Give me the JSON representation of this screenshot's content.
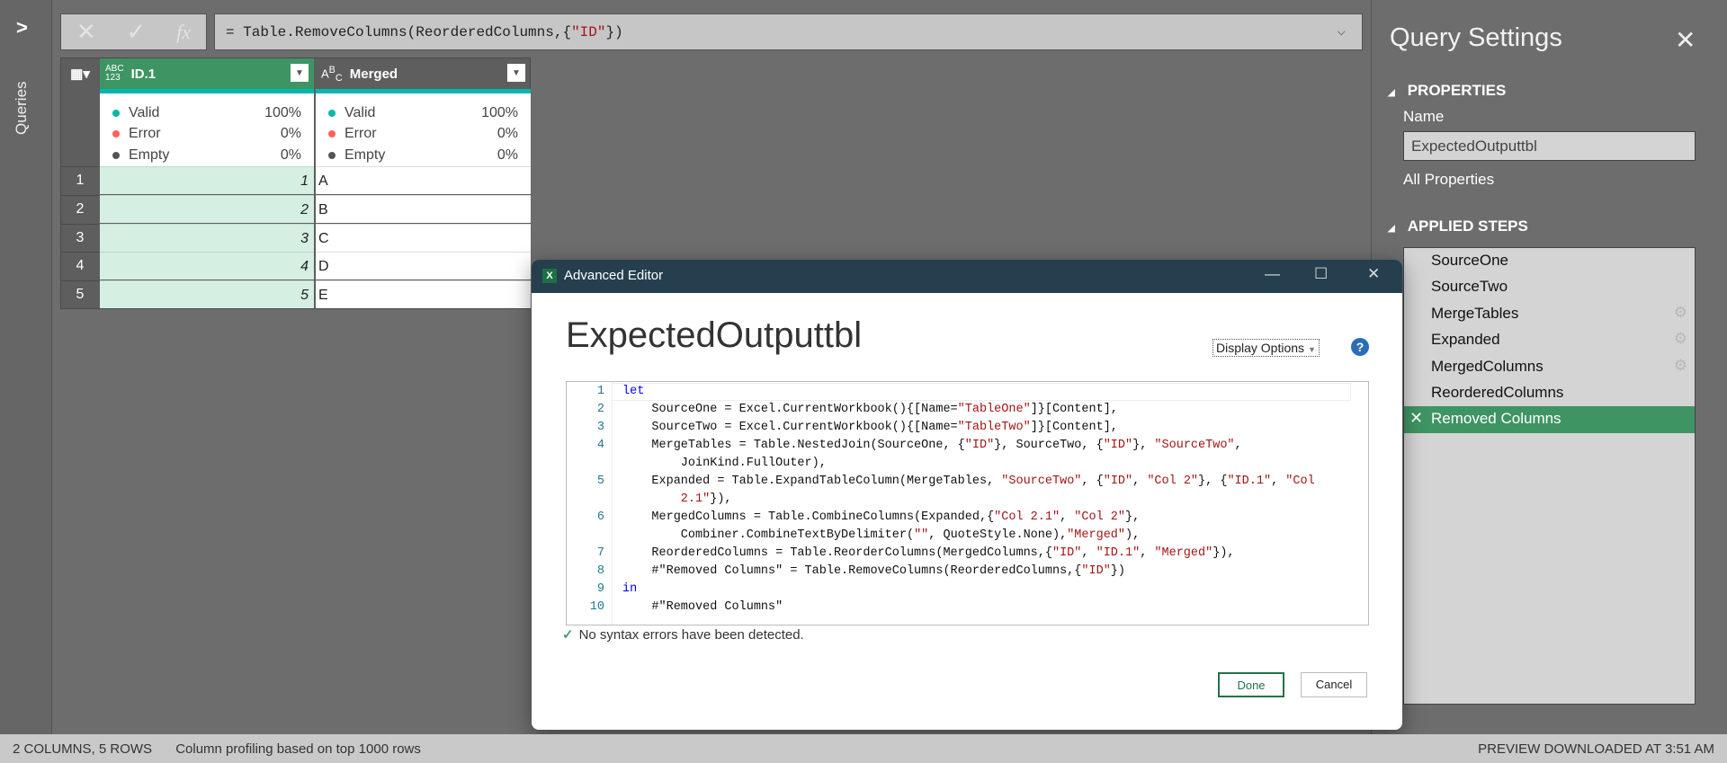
{
  "queries_pane": {
    "label": "Queries"
  },
  "formula_bar": {
    "cancel_icon": "✕",
    "confirm_icon": "✓",
    "fx_label": "fx",
    "prefix": "= ",
    "func": "Table.RemoveColumns(ReorderedColumns,{",
    "str": "\"ID\"",
    "suffix": "})"
  },
  "grid": {
    "columns": [
      {
        "name": "ID.1",
        "type": "ABC/123"
      },
      {
        "name": "Merged",
        "type": "ABC"
      }
    ],
    "profile": [
      {
        "valid": "100%",
        "error": "0%",
        "empty": "0%"
      },
      {
        "valid": "100%",
        "error": "0%",
        "empty": "0%"
      }
    ],
    "profile_labels": {
      "valid": "Valid",
      "error": "Error",
      "empty": "Empty"
    },
    "rows": [
      [
        "1",
        "1",
        "A"
      ],
      [
        "2",
        "2",
        "B"
      ],
      [
        "3",
        "3",
        "C"
      ],
      [
        "4",
        "4",
        "D"
      ],
      [
        "5",
        "5",
        "E"
      ]
    ],
    "colors": {
      "header": "#3f9464",
      "valid": "#01b8aa",
      "error": "#fd625e",
      "empty": "#555555"
    }
  },
  "query_settings": {
    "title": "Query Settings",
    "properties": "PROPERTIES",
    "name_label": "Name",
    "name_value": "ExpectedOutputtbl",
    "all_properties": "All Properties",
    "applied_steps": "APPLIED STEPS",
    "steps": [
      {
        "label": "SourceOne"
      },
      {
        "label": "SourceTwo"
      },
      {
        "label": "MergeTables",
        "gear": true
      },
      {
        "label": "Expanded",
        "gear": true
      },
      {
        "label": "MergedColumns",
        "gear": true
      },
      {
        "label": "ReorderedColumns"
      },
      {
        "label": "Removed Columns",
        "selected": true
      }
    ]
  },
  "dialog": {
    "title": "Advanced Editor",
    "query_name": "ExpectedOutputtbl",
    "display_options": "Display Options",
    "help": "?",
    "code": [
      {
        "n": "1",
        "t": [
          [
            "kw",
            "let"
          ]
        ]
      },
      {
        "n": "2",
        "t": [
          [
            "",
            "    SourceOne = Excel.CurrentWorkbook(){[Name="
          ],
          [
            "s",
            "\"TableOne\""
          ],
          [
            "",
            "]}[Content],"
          ]
        ]
      },
      {
        "n": "3",
        "t": [
          [
            "",
            "    SourceTwo = Excel.CurrentWorkbook(){[Name="
          ],
          [
            "s",
            "\"TableTwo\""
          ],
          [
            "",
            "]}[Content],"
          ]
        ]
      },
      {
        "n": "4",
        "t": [
          [
            "",
            "    MergeTables = Table.NestedJoin(SourceOne, {"
          ],
          [
            "s",
            "\"ID\""
          ],
          [
            "",
            "}, SourceTwo, {"
          ],
          [
            "s",
            "\"ID\""
          ],
          [
            "",
            "}, "
          ],
          [
            "s",
            "\"SourceTwo\""
          ],
          [
            "",
            ","
          ]
        ]
      },
      {
        "n": "",
        "t": [
          [
            "",
            "        JoinKind.FullOuter),"
          ]
        ]
      },
      {
        "n": "5",
        "t": [
          [
            "",
            "    Expanded = Table.ExpandTableColumn(MergeTables, "
          ],
          [
            "s",
            "\"SourceTwo\""
          ],
          [
            "",
            ", {"
          ],
          [
            "s",
            "\"ID\""
          ],
          [
            "",
            ", "
          ],
          [
            "s",
            "\"Col 2\""
          ],
          [
            "",
            "}, {"
          ],
          [
            "s",
            "\"ID.1\""
          ],
          [
            "",
            ", "
          ],
          [
            "s",
            "\"Col"
          ]
        ]
      },
      {
        "n": "",
        "t": [
          [
            "s",
            "        2.1\""
          ],
          [
            "",
            "}),"
          ]
        ]
      },
      {
        "n": "6",
        "t": [
          [
            "",
            "    MergedColumns = Table.CombineColumns(Expanded,{"
          ],
          [
            "s",
            "\"Col 2.1\""
          ],
          [
            "",
            ", "
          ],
          [
            "s",
            "\"Col 2\""
          ],
          [
            "",
            "},"
          ]
        ]
      },
      {
        "n": "",
        "t": [
          [
            "",
            "        Combiner.CombineTextByDelimiter("
          ],
          [
            "s",
            "\"\""
          ],
          [
            "",
            ", QuoteStyle.None),"
          ],
          [
            "s",
            "\"Merged\""
          ],
          [
            "",
            "),"
          ]
        ]
      },
      {
        "n": "7",
        "t": [
          [
            "",
            "    ReorderedColumns = Table.ReorderColumns(MergedColumns,{"
          ],
          [
            "s",
            "\"ID\""
          ],
          [
            "",
            ", "
          ],
          [
            "s",
            "\"ID.1\""
          ],
          [
            "",
            ", "
          ],
          [
            "s",
            "\"Merged\""
          ],
          [
            "",
            "}),"
          ]
        ]
      },
      {
        "n": "8",
        "t": [
          [
            "",
            "    #\"Removed Columns\" = Table.RemoveColumns(ReorderedColumns,{"
          ],
          [
            "s",
            "\"ID\""
          ],
          [
            "",
            "})"
          ]
        ]
      },
      {
        "n": "9",
        "t": [
          [
            "kw",
            "in"
          ]
        ]
      },
      {
        "n": "10",
        "t": [
          [
            "",
            "    #\"Removed Columns\""
          ]
        ]
      }
    ],
    "syntax_status": "No syntax errors have been detected.",
    "done": "Done",
    "cancel": "Cancel"
  },
  "status_bar": {
    "left": "2 COLUMNS, 5 ROWS",
    "profiling": "Column profiling based on top 1000 rows",
    "right": "PREVIEW DOWNLOADED AT 3:51 AM"
  }
}
